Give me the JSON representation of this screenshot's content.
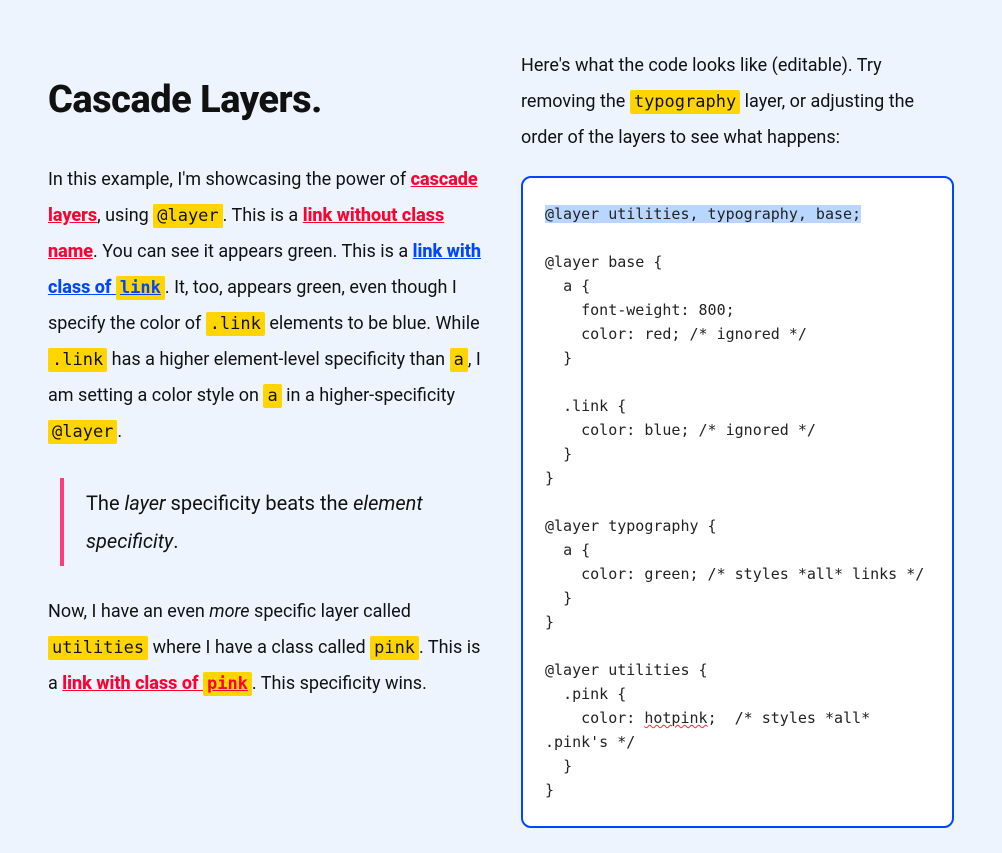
{
  "left": {
    "heading": "Cascade Layers.",
    "p1": {
      "t0": "In this example, I'm showcasing the power of ",
      "link_cascade": "cascade layers",
      "t1": ", using ",
      "code_layer1": "@layer",
      "t2": ". This is a ",
      "link_noname": "link without class name",
      "t3": ". You can see it appears green. This is a ",
      "link_withclass_pre": "link with class of ",
      "code_link_in_link": "link",
      "t4": ". It, too, appears green, even though I specify the color of ",
      "code_dotlink1": ".link",
      "t5": " elements to be blue. While ",
      "code_dotlink2": ".link",
      "t6": " has a higher element-level specificity than ",
      "code_a1": "a",
      "t7": ", I am setting a color style on ",
      "code_a2": "a",
      "t8": " in a higher-specificity ",
      "code_layer2": "@layer",
      "t9": "."
    },
    "quote": {
      "t0": "The ",
      "em1": "layer",
      "t1": " specificity beats the ",
      "em2": "element specificity",
      "t2": "."
    },
    "p2": {
      "t0": "Now, I have an even ",
      "em_more": "more",
      "t1": " specific layer called ",
      "code_utilities": "utilities",
      "t2": " where I have a class called ",
      "code_pink1": "pink",
      "t3": ". This is a ",
      "link_pink_pre": "link with class of ",
      "code_pink_in_link": "pink",
      "t4": ". This specificity wins."
    }
  },
  "right": {
    "intro": {
      "t0": "Here's what the code looks like (editable). Try removing the ",
      "code_typography": "typography",
      "t1": " layer, or adjusting the order of the layers to see what happens:"
    },
    "code": {
      "line_sel": "@layer utilities, typography, base;",
      "base_open": "@layer base {",
      "base_a_open": "  a {",
      "base_fw": "    font-weight: 800;",
      "base_color": "    color: red; /* ignored */",
      "base_a_close": "  }",
      "base_link_open": "  .link {",
      "base_link_color": "    color: blue; /* ignored */",
      "base_link_close": "  }",
      "base_close": "}",
      "typo_open": "@layer typography {",
      "typo_a_open": "  a {",
      "typo_color": "    color: green; /* styles *all* links */",
      "typo_a_close": "  }",
      "typo_close": "}",
      "util_open": "@layer utilities {",
      "util_pink_open": "  .pink {",
      "util_color_pre": "    color: ",
      "util_hotpink": "hotpink",
      "util_color_post": ";  /* styles *all* .pink's */",
      "util_pink_close": "  }",
      "util_close": "}"
    }
  }
}
